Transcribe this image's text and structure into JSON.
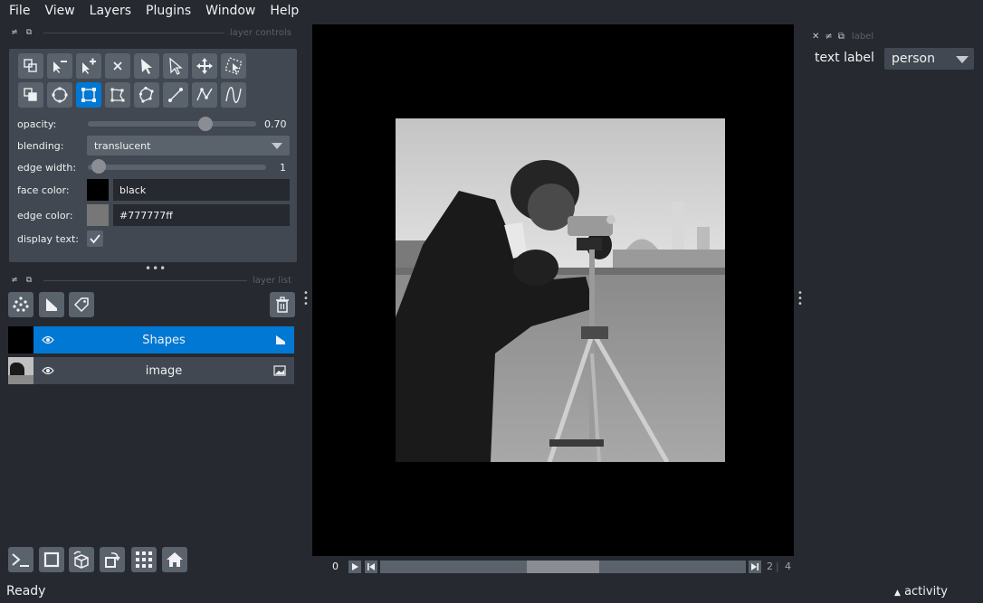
{
  "menu": [
    "File",
    "View",
    "Layers",
    "Plugins",
    "Window",
    "Help"
  ],
  "docks": {
    "layer_controls_title": "layer controls",
    "layer_list_title": "layer list",
    "label_title": "label"
  },
  "controls": {
    "opacity_label": "opacity:",
    "opacity_value": "0.70",
    "opacity_fraction": 0.7,
    "blending_label": "blending:",
    "blending_value": "translucent",
    "edge_width_label": "edge width:",
    "edge_width_value": "1",
    "face_color_label": "face color:",
    "face_color_value": "black",
    "face_color_hex": "#000000",
    "edge_color_label": "edge color:",
    "edge_color_value": "#777777ff",
    "edge_color_hex": "#777777",
    "display_text_label": "display text:",
    "display_text_checked": true
  },
  "tools": [
    "move-back-icon",
    "remove-vertex-icon",
    "add-vertex-icon",
    "delete-icon",
    "select-icon",
    "direct-select-icon",
    "pan-zoom-icon",
    "transform-icon",
    "move-front-icon",
    "ellipse-icon",
    "rectangle-icon",
    "polygon-icon",
    "polygon-lasso-icon",
    "line-icon",
    "path-icon",
    "polyline-icon"
  ],
  "layers": [
    {
      "name": "Shapes",
      "selected": true,
      "type_icon": "shapes-layer-icon"
    },
    {
      "name": "image",
      "selected": false,
      "type_icon": "image-layer-icon"
    }
  ],
  "dims": {
    "current": "0",
    "position": "2",
    "total": "4"
  },
  "right_panel": {
    "text_label": "text label",
    "label_value": "person"
  },
  "status": {
    "text": "Ready",
    "activity": "activity"
  },
  "colors": {
    "accent": "#0078d4",
    "bg": "#262930",
    "panel": "#414851",
    "button": "#5a626c"
  }
}
